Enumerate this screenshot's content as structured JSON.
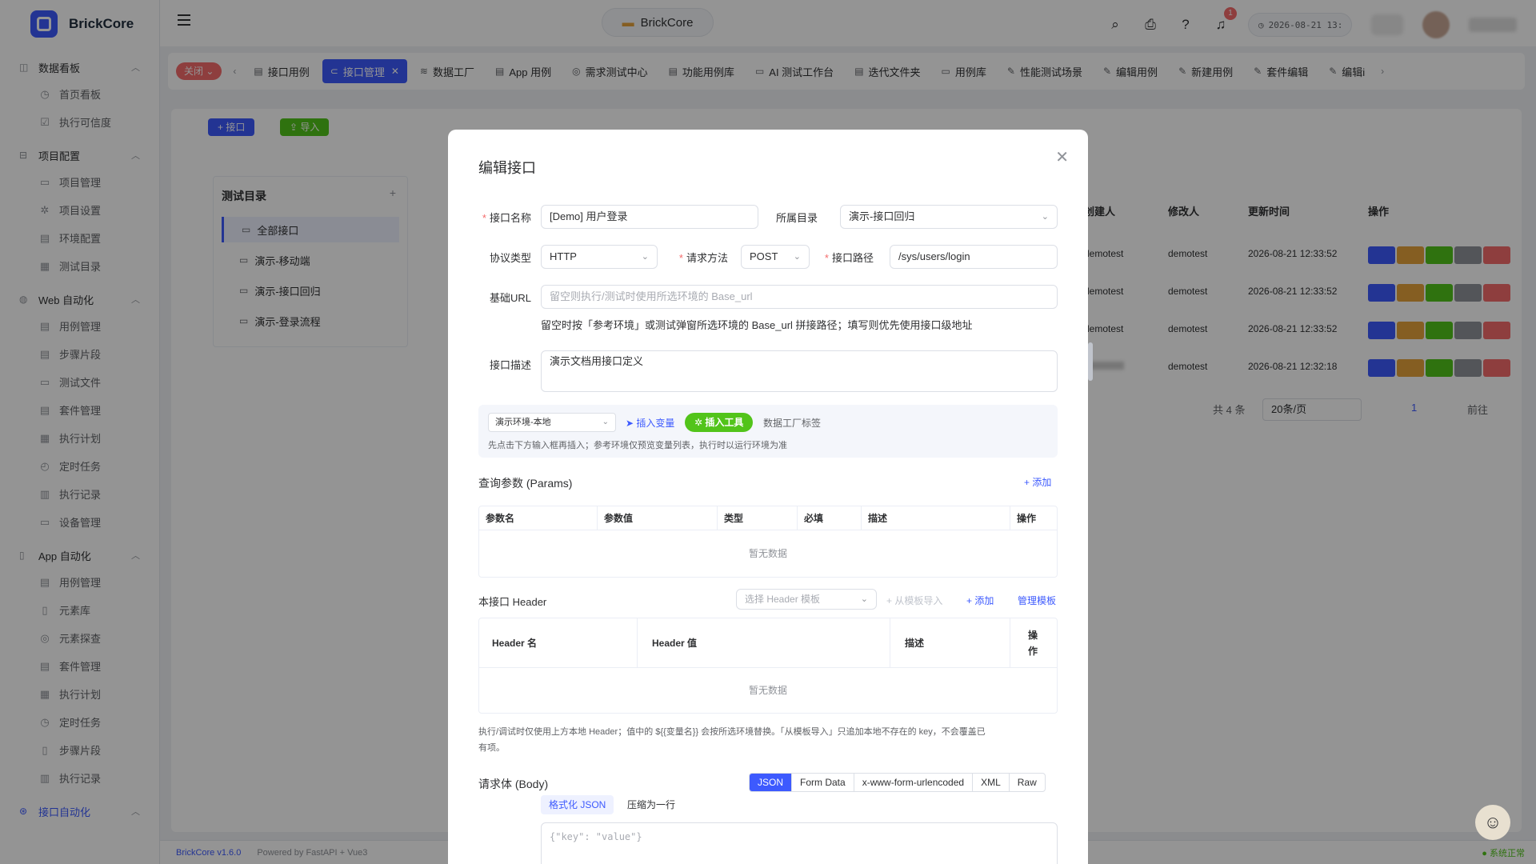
{
  "brand": {
    "name": "BrickCore"
  },
  "sidebar": {
    "groups": [
      {
        "label": "数据看板",
        "items": [
          {
            "label": "首页看板"
          },
          {
            "label": "执行可信度"
          }
        ]
      },
      {
        "label": "项目配置",
        "items": [
          {
            "label": "项目管理"
          },
          {
            "label": "项目设置"
          },
          {
            "label": "环境配置"
          },
          {
            "label": "测试目录"
          }
        ]
      },
      {
        "label": "Web 自动化",
        "items": [
          {
            "label": "用例管理"
          },
          {
            "label": "步骤片段"
          },
          {
            "label": "测试文件"
          },
          {
            "label": "套件管理"
          },
          {
            "label": "执行计划"
          },
          {
            "label": "定时任务"
          },
          {
            "label": "执行记录"
          },
          {
            "label": "设备管理"
          }
        ]
      },
      {
        "label": "App 自动化",
        "items": [
          {
            "label": "用例管理"
          },
          {
            "label": "元素库"
          },
          {
            "label": "元素探查"
          },
          {
            "label": "套件管理"
          },
          {
            "label": "执行计划"
          },
          {
            "label": "定时任务"
          },
          {
            "label": "步骤片段"
          },
          {
            "label": "执行记录"
          }
        ]
      },
      {
        "label": "接口自动化",
        "items": []
      }
    ]
  },
  "topbar": {
    "project": "BrickCore",
    "notification_count": "1",
    "datetime": "2026-08-21 13:"
  },
  "tabs": {
    "close_label": "关闭",
    "items": [
      {
        "label": "接口用例",
        "active": false
      },
      {
        "label": "接口管理",
        "active": true
      },
      {
        "label": "数据工厂",
        "active": false
      },
      {
        "label": "App 用例",
        "active": false
      },
      {
        "label": "需求测试中心",
        "active": false
      },
      {
        "label": "功能用例库",
        "active": false
      },
      {
        "label": "AI 测试工作台",
        "active": false
      },
      {
        "label": "迭代文件夹",
        "active": false
      },
      {
        "label": "用例库",
        "active": false
      },
      {
        "label": "性能测试场景",
        "active": false
      },
      {
        "label": "编辑用例",
        "active": false
      },
      {
        "label": "新建用例",
        "active": false
      },
      {
        "label": "套件编辑",
        "active": false
      },
      {
        "label": "编辑i",
        "active": false
      }
    ]
  },
  "page": {
    "add_btn": "+ 接口",
    "import_btn": "导入",
    "dir_title": "测试目录",
    "dirs": [
      {
        "label": "全部接口"
      },
      {
        "label": "演示-移动端"
      },
      {
        "label": "演示-接口回归"
      },
      {
        "label": "演示-登录流程"
      }
    ],
    "table_headers": {
      "creator": "创建人",
      "modifier": "修改人",
      "updated": "更新时间",
      "ops": "操作"
    },
    "rows": [
      {
        "creator": "demotest",
        "modifier": "demotest",
        "updated": "2026-08-21 12:33:52"
      },
      {
        "creator": "demotest",
        "modifier": "demotest",
        "updated": "2026-08-21 12:33:52"
      },
      {
        "creator": "demotest",
        "modifier": "demotest",
        "updated": "2026-08-21 12:33:52"
      },
      {
        "creator": "",
        "modifier": "demotest",
        "updated": "2026-08-21 12:32:18"
      }
    ],
    "total": "共 4 条",
    "page_size": "20条/页",
    "current_page": "1",
    "goto": "前往"
  },
  "footer": {
    "version": "BrickCore v1.6.0",
    "powered": "Powered by FastAPI + Vue3",
    "status": "系统正常"
  },
  "modal": {
    "title": "编辑接口",
    "name_label": "接口名称",
    "name_value": "[Demo] 用户登录",
    "dir_label": "所属目录",
    "dir_value": "演示-接口回归",
    "protocol_label": "协议类型",
    "protocol_value": "HTTP",
    "method_label": "请求方法",
    "method_value": "POST",
    "path_label": "接口路径",
    "path_value": "/sys/users/login",
    "base_label": "基础URL",
    "base_placeholder": "留空则执行/测试时使用所选环境的 Base_url",
    "base_hint": "留空时按「参考环境」或测试弹窗所选环境的 Base_url 拼接路径；填写则优先使用接口级地址",
    "desc_label": "接口描述",
    "desc_value": "演示文档用接口定义",
    "env_value": "演示环境-本地",
    "insert_var": "插入变量",
    "insert_tool": "插入工具",
    "factory_tag": "数据工厂标签",
    "tool_hint": "先点击下方输入框再插入；参考环境仅预览变量列表，执行时以运行环境为准",
    "params_title": "查询参数 (Params)",
    "add_label": "+ 添加",
    "params_cols": [
      "参数名",
      "参数值",
      "类型",
      "必填",
      "描述",
      "操作"
    ],
    "empty": "暂无数据",
    "header_title": "本接口 Header",
    "header_template_placeholder": "选择 Header 模板",
    "import_from_template": "+ 从模板导入",
    "manage_template": "管理模板",
    "header_cols": [
      "Header 名",
      "Header 值",
      "描述",
      "操\n作"
    ],
    "header_hint_1": "执行/调试时仅使用上方本地 Header；值中的 ${{变量名}} 会按所选环境替换。「从模板导入」只追加本地不存在的 key，不会覆盖已",
    "header_hint_2": "有项。",
    "body_title": "请求体 (Body)",
    "body_types": [
      "JSON",
      "Form Data",
      "x-www-form-urlencoded",
      "XML",
      "Raw"
    ],
    "format_json": "格式化 JSON",
    "compress": "压缩为一行",
    "body_placeholder": "{\"key\": \"value\"}"
  },
  "colors": {
    "accent": "#3d5afe",
    "danger": "#f56c6c",
    "success": "#52c41a"
  }
}
